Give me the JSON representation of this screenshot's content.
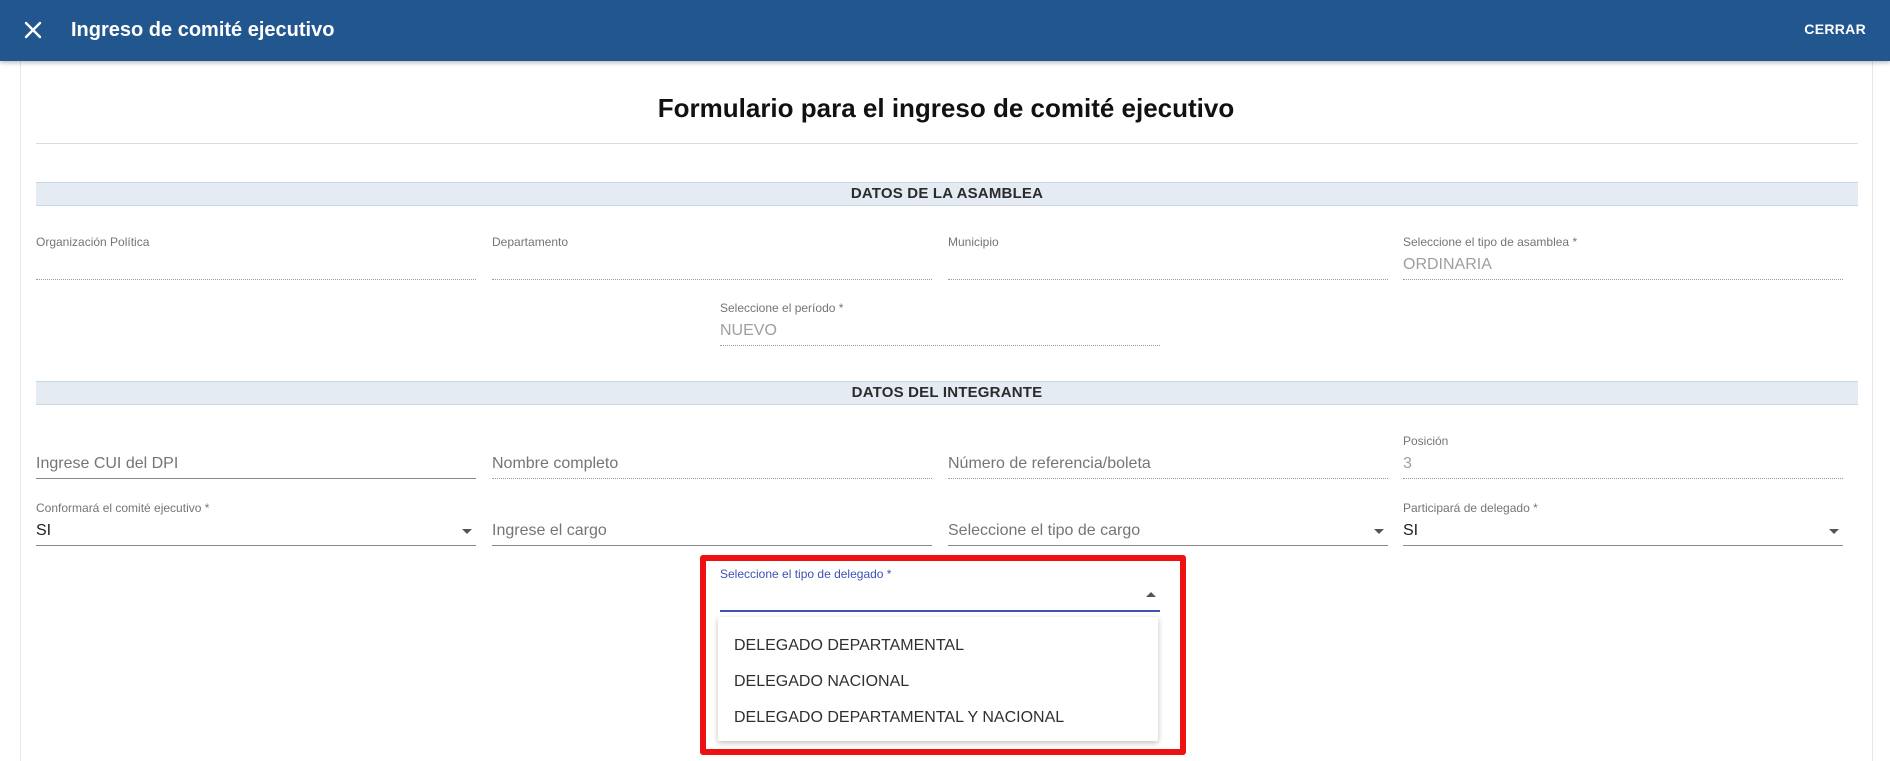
{
  "header": {
    "title": "Ingreso de comité ejecutivo",
    "close_label": "CERRAR"
  },
  "form": {
    "title": "Formulario para el ingreso de comité ejecutivo"
  },
  "asamblea": {
    "section_title": "DATOS DE LA ASAMBLEA",
    "organizacion": {
      "label": "Organización Política",
      "value": ""
    },
    "departamento": {
      "label": "Departamento",
      "value": ""
    },
    "municipio": {
      "label": "Municipio",
      "value": ""
    },
    "tipo_asamblea": {
      "label": "Seleccione el tipo de asamblea *",
      "value": "ORDINARIA"
    },
    "periodo": {
      "label": "Seleccione el período *",
      "value": "NUEVO"
    }
  },
  "integrante": {
    "section_title": "DATOS DEL INTEGRANTE",
    "cui": {
      "placeholder": "Ingrese CUI del DPI"
    },
    "nombre": {
      "placeholder": "Nombre completo"
    },
    "referencia": {
      "placeholder": "Número de referencia/boleta"
    },
    "posicion": {
      "label": "Posición",
      "value": "3"
    },
    "conformara": {
      "label": "Conformará el comité ejecutivo *",
      "value": "SI"
    },
    "cargo": {
      "placeholder": "Ingrese el cargo"
    },
    "tipo_cargo": {
      "placeholder": "Seleccione el tipo de cargo"
    },
    "participara": {
      "label": "Participará de delegado *",
      "value": "SI"
    },
    "tipo_delegado": {
      "label": "Seleccione el tipo de delegado *",
      "value": "",
      "options": [
        "DELEGADO DEPARTAMENTAL",
        "DELEGADO NACIONAL",
        "DELEGADO DEPARTAMENTAL Y NACIONAL"
      ]
    }
  },
  "colors": {
    "header_bg": "#22568f",
    "section_bg": "#e4ebf3",
    "focus": "#3f51b5",
    "highlight": "#ee1111"
  }
}
